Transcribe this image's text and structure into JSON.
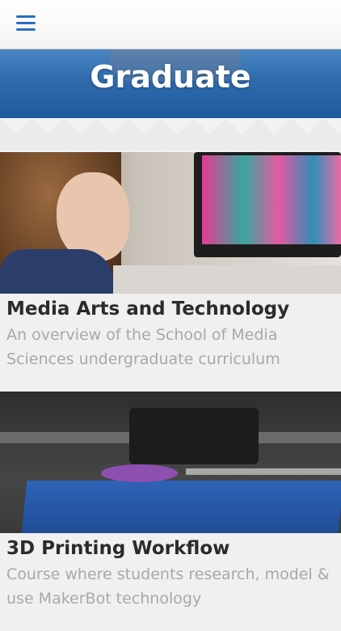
{
  "header": {
    "menu_icon": "hamburger-menu-icon",
    "title": "Graduate"
  },
  "colors": {
    "accent": "#2a6fc0",
    "banner": "#2f6bad"
  },
  "courses": [
    {
      "title": "Media Arts and Technology",
      "description": "An overview of the School of Media Sciences undergraduate curriculum"
    },
    {
      "title": "3D Printing Workflow",
      "description": "Course where students research, model & use MakerBot technology"
    }
  ]
}
